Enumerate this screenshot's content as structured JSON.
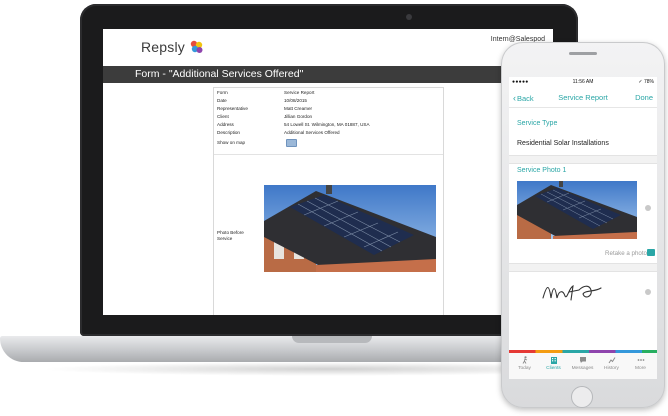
{
  "laptop": {
    "logo_text": "Repsly",
    "user": "Intern@Salespod",
    "form_title": "Form - \"Additional Services Offered\"",
    "details": [
      {
        "label": "Form",
        "value": "Service Report"
      },
      {
        "label": "Date",
        "value": "10/08/2015"
      },
      {
        "label": "Representative",
        "value": "Matt Creamer"
      },
      {
        "label": "Client",
        "value": "Jillian Gordon"
      },
      {
        "label": "Address",
        "value": "54 Lowell St. Wilmington, MA 01887, USA"
      },
      {
        "label": "Description",
        "value": "Additional Services Offered"
      },
      {
        "label": "Show on map",
        "value": ""
      }
    ],
    "photo_label_line1": "Photo Before",
    "photo_label_line2": "Service"
  },
  "phone": {
    "status": {
      "carrier": "●●●●● ",
      "time": "11:56 AM",
      "battery": "✓ 78%"
    },
    "nav": {
      "back": "Back",
      "title": "Service Report",
      "done": "Done"
    },
    "service_type_label": "Service Type",
    "service_type_value": "Residential Solar Installations",
    "photo_section_label": "Service Photo 1",
    "retake_label": "Retake a photo",
    "tabs": [
      {
        "label": "Today",
        "icon": "walk-icon"
      },
      {
        "label": "Clients",
        "icon": "building-icon"
      },
      {
        "label": "Messages",
        "icon": "chat-icon"
      },
      {
        "label": "History",
        "icon": "history-icon"
      },
      {
        "label": "More",
        "icon": "more-icon"
      }
    ],
    "active_tab": "Clients"
  },
  "colors": {
    "accent": "#2aa6a6",
    "header_bar": "#3c3c3c"
  }
}
